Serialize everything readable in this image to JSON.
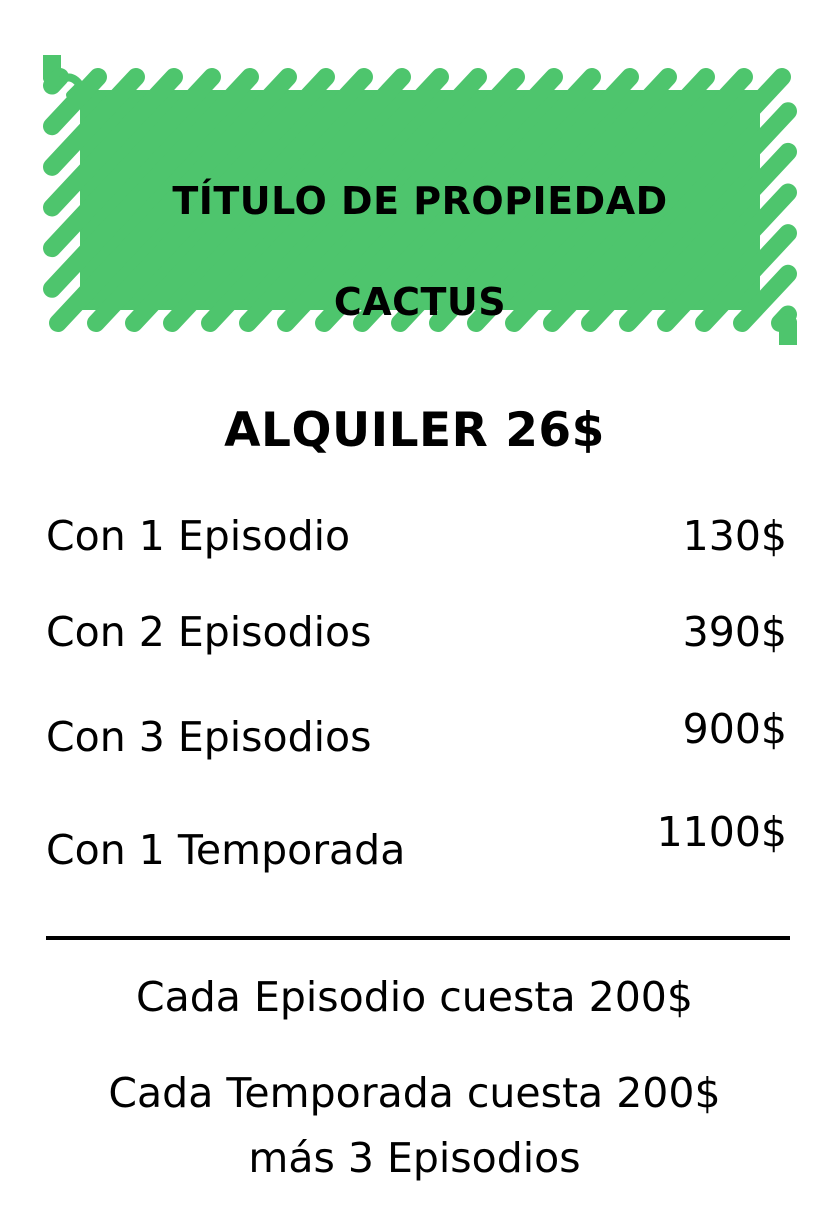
{
  "header": {
    "title": "TÍTULO DE PROPIEDAD",
    "property_name": "CACTUS",
    "scribble_color": "#4ec56d"
  },
  "rent": "ALQUILER 26$",
  "rows": [
    {
      "label": "Con 1 Episodio",
      "price": "130$"
    },
    {
      "label": "Con 2 Episodios",
      "price": "390$"
    },
    {
      "label": "Con 3 Episodios",
      "price": "900$"
    },
    {
      "label": "Con 1 Temporada",
      "price": "1100$"
    }
  ],
  "notes": {
    "episode_cost": "Cada Episodio cuesta 200$",
    "season_cost_line1": "Cada Temporada cuesta 200$",
    "season_cost_line2": "más 3 Episodios"
  }
}
